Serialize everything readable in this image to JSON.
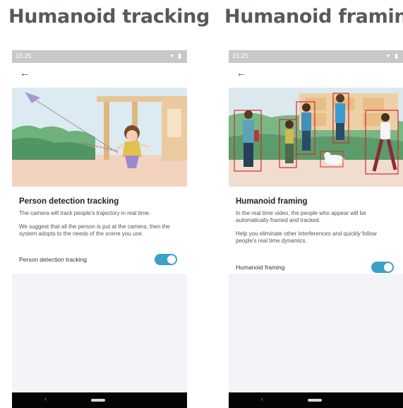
{
  "panels": [
    {
      "heading": "Humanoid tracking",
      "status_time": "15:25",
      "status_icons": "▾ ▮",
      "back_glyph": "←",
      "title": "Person detection tracking",
      "description_1": "The camera will track people's trajectory in real time.",
      "description_2": "We suggest that all the person is put at the camera, then the system adopts to the needs of the scene you use.",
      "toggle_label": "Person detection tracking",
      "toggle_on": true
    },
    {
      "heading": "Humanoid framing",
      "status_time": "15:25",
      "status_icons": "▾ ▮",
      "back_glyph": "←",
      "title": "Humanoid framing",
      "description_1": "In the real time video, the people who appear will be automatically framed and tracked.",
      "description_2": "Help you eliminate other interferences and quickly follow people's real time dynamics.",
      "toggle_label": "Humanoid framing",
      "toggle_on": true
    }
  ],
  "colors": {
    "accent": "#3aa2c6",
    "frame_box": "#d42b2b",
    "heading": "#555a5e"
  }
}
